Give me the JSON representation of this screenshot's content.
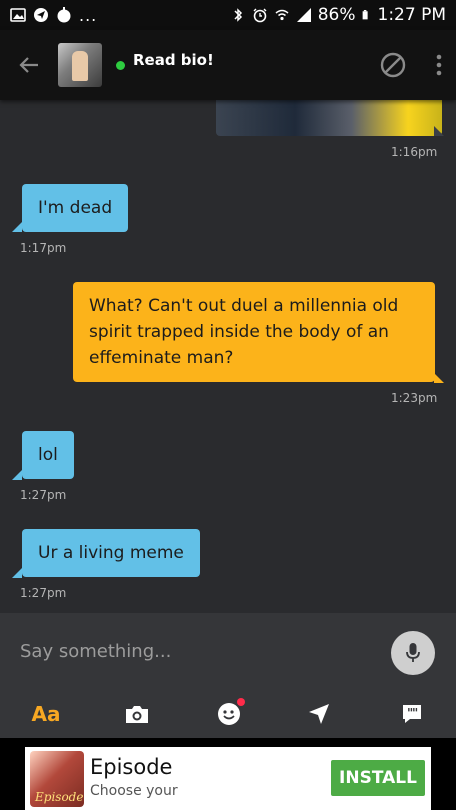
{
  "status_bar": {
    "dots": "...",
    "battery": "86%",
    "time": "1:27 PM"
  },
  "header": {
    "title": "Read bio!"
  },
  "messages": [
    {
      "direction": "out",
      "type": "image",
      "time": "1:16pm"
    },
    {
      "direction": "in",
      "text": "I'm dead",
      "time": "1:17pm"
    },
    {
      "direction": "out",
      "text": "What? Can't out duel a millennia old spirit trapped inside the body of an effeminate man?",
      "time": "1:23pm"
    },
    {
      "direction": "in",
      "text": "lol",
      "time": "1:27pm"
    },
    {
      "direction": "in",
      "text": "Ur a living meme",
      "time": "1:27pm"
    }
  ],
  "composer": {
    "placeholder": "Say something...",
    "format_label": "Aa"
  },
  "ad": {
    "title": "Episode",
    "subtitle": "Choose your",
    "icon_text": "Episode",
    "button": "INSTALL"
  },
  "colors": {
    "incoming_bubble": "#62c0e7",
    "outgoing_bubble": "#fcb31a",
    "accent": "#f7a823",
    "online": "#2ecc40",
    "install": "#4dab45"
  }
}
